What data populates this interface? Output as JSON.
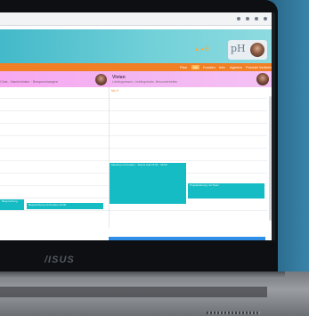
{
  "brand_logo": "/ISUS",
  "app": {
    "header_icons": "▲●☰",
    "logo": "pH",
    "nav": {
      "items": [
        {
          "label": "Plan",
          "active": false
        },
        {
          "label": "Mit",
          "active": true
        },
        {
          "label": "Kunden",
          "active": false
        },
        {
          "label": "Info",
          "active": false
        },
        {
          "label": "Agentur",
          "active": false
        },
        {
          "label": "Produkt Vertrieb",
          "active": false
        }
      ]
    },
    "chat_banner": {
      "left_text": "Chat - Nachrichten · Besprechungen",
      "name": "Vivian",
      "description": "Lieblingsessen, Lieblingsfarbe, Besonderheiten"
    },
    "calendar": {
      "column_header": "Mo\n9",
      "events": [
        {
          "label": "Besprechung"
        },
        {
          "label": "Besprechung mit Kunden 12:00"
        },
        {
          "label": "Meeting mit Kunden · Teams Call 15:00 · 16:00"
        },
        {
          "label": "Projektplanung mit Team"
        }
      ]
    }
  },
  "colors": {
    "header_teal": "#43b9c9",
    "nav_orange": "#f17f25",
    "banner_pink": "#f7a8f0",
    "event_teal": "#16bcc3",
    "accent_blue": "#2f8fe6"
  }
}
